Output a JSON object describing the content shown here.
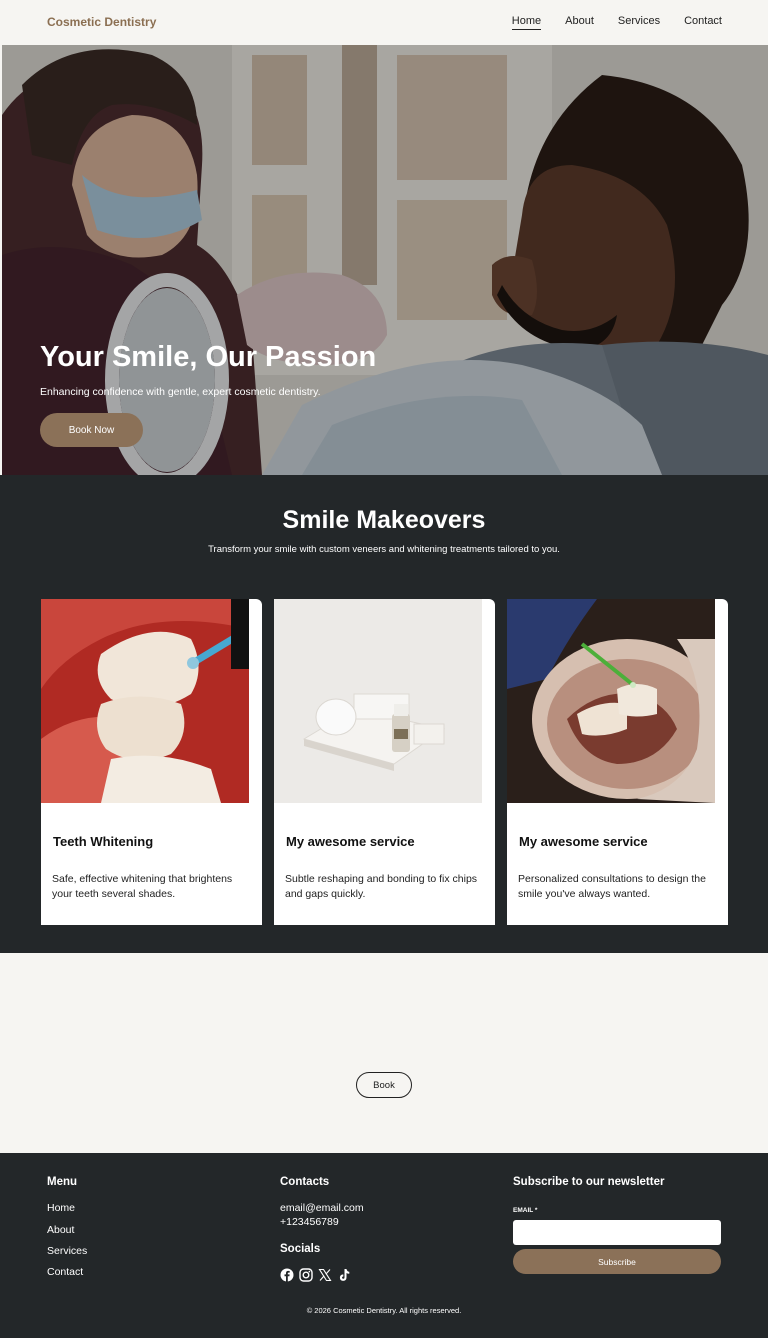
{
  "header": {
    "logo": "Cosmetic Dentistry",
    "nav": [
      "Home",
      "About",
      "Services",
      "Contact"
    ]
  },
  "hero": {
    "title": "Your Smile, Our Passion",
    "subtitle": "Enhancing confidence with gentle, expert cosmetic dentistry.",
    "cta_label": "Book Now"
  },
  "makeovers": {
    "title": "Smile Makeovers",
    "subtitle": "Transform your smile with custom veneers and whitening treatments tailored to you.",
    "cards": [
      {
        "title": "Teeth Whitening",
        "desc": "Safe, effective whitening that brightens your teeth several shades."
      },
      {
        "title": "My awesome service",
        "desc": "Subtle reshaping and bonding to fix chips and gaps quickly."
      },
      {
        "title": "My awesome service",
        "desc": "Personalized consultations to design the smile you've always wanted."
      }
    ]
  },
  "cta": {
    "label": "Book"
  },
  "footer": {
    "menu_title": "Menu",
    "menu": [
      "Home",
      "About",
      "Services",
      "Contact"
    ],
    "contacts_title": "Contacts",
    "email": "email@email.com",
    "phone": "+123456789",
    "socials_title": "Socials",
    "socials": [
      "facebook-icon",
      "instagram-icon",
      "x-icon",
      "tiktok-icon"
    ],
    "newsletter_title": "Subscribe to our newsletter",
    "email_label": "EMAIL *",
    "email_value": "",
    "subscribe_label": "Subscribe",
    "copyright": "© 2026 Cosmetic Dentistry. All rights reserved."
  },
  "colors": {
    "accent": "#8b7158",
    "dark": "#232729",
    "light": "#f6f5f2",
    "logo": "#8b6f52"
  }
}
